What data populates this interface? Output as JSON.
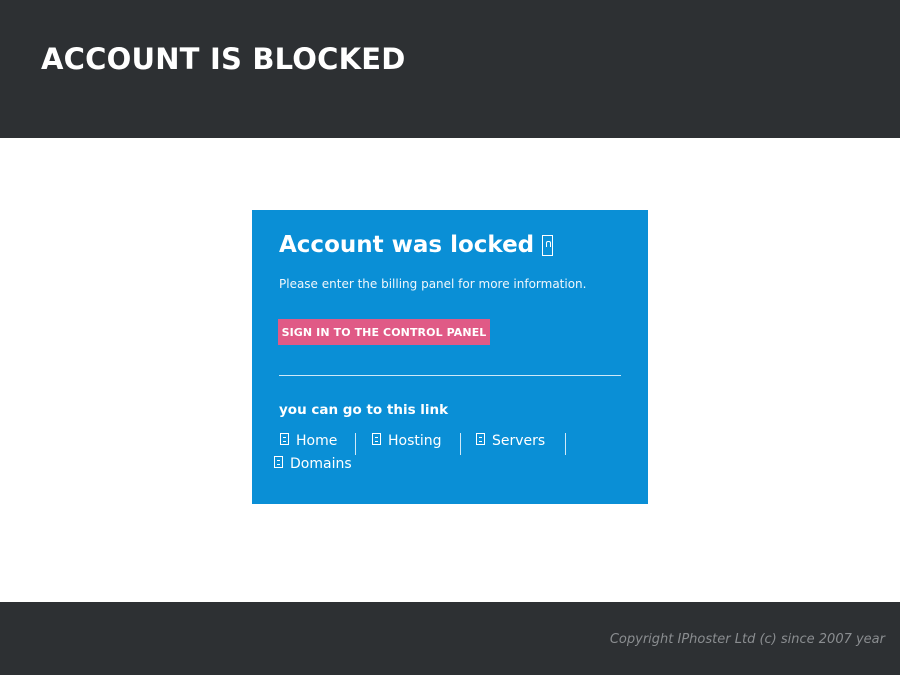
{
  "header": {
    "title": "ACCOUNT IS BLOCKED"
  },
  "panel": {
    "title": "Account was locked",
    "title_icon": "lock-icon",
    "message": "Please enter the billing panel for more information.",
    "signin_label": "SIGN IN TO THE CONTROL PANEL",
    "links_title": "you can go to this link",
    "links": [
      {
        "label": "Home",
        "icon": "page-icon"
      },
      {
        "label": "Hosting",
        "icon": "page-icon"
      },
      {
        "label": "Servers",
        "icon": "page-icon"
      },
      {
        "label": "Domains",
        "icon": "page-icon"
      }
    ]
  },
  "footer": {
    "copyright": "Copyright IPhoster Ltd (c) since 2007 year"
  },
  "colors": {
    "header_bg": "#2d3033",
    "panel_bg": "#0a8fd6",
    "button_bg": "#e05a86"
  }
}
